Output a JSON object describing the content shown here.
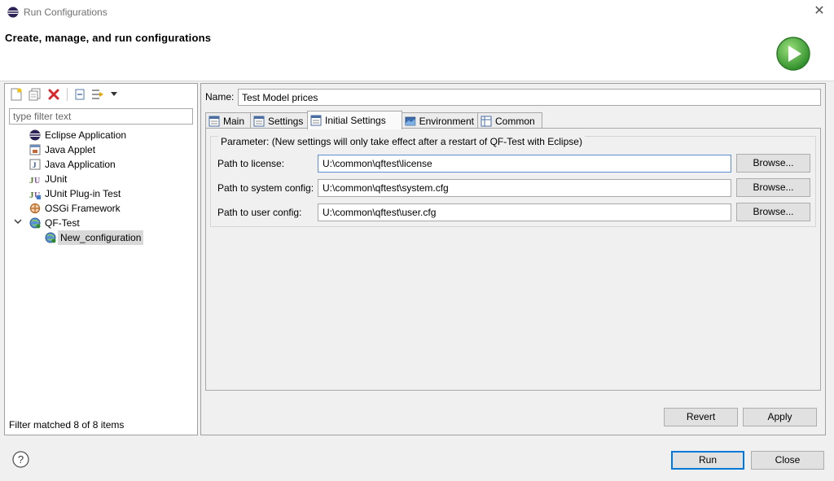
{
  "window": {
    "title": "Run Configurations",
    "close_glyph": "✕"
  },
  "banner": {
    "heading": "Create, manage, and run configurations",
    "icon": "run-icon"
  },
  "left_panel": {
    "toolbar": [
      "new-configuration-icon",
      "duplicate-icon",
      "delete-icon",
      "collapse-all-icon",
      "filter-icon",
      "view-menu-icon"
    ],
    "filter_placeholder": "type filter text",
    "tree": [
      {
        "label": "Eclipse Application",
        "icon": "eclipse-icon"
      },
      {
        "label": "Java Applet",
        "icon": "java-applet-icon"
      },
      {
        "label": "Java Application",
        "icon": "java-application-icon"
      },
      {
        "label": "JUnit",
        "icon": "junit-icon"
      },
      {
        "label": "JUnit Plug-in Test",
        "icon": "junit-plugin-icon"
      },
      {
        "label": "OSGi Framework",
        "icon": "osgi-icon"
      },
      {
        "label": "QF-Test",
        "icon": "qftest-icon",
        "expanded": true
      },
      {
        "label": "New_configuration",
        "icon": "qftest-config-icon",
        "selected": true
      }
    ],
    "status": "Filter matched 8 of 8 items"
  },
  "form": {
    "name_label": "Name:",
    "name_value": "Test Model prices",
    "tabs": [
      {
        "label": "Main",
        "icon": "main-tab-icon"
      },
      {
        "label": "Settings",
        "icon": "settings-tab-icon"
      },
      {
        "label": "Initial Settings",
        "icon": "initial-settings-tab-icon",
        "active": true
      },
      {
        "label": "Environment",
        "icon": "environment-tab-icon"
      },
      {
        "label": "Common",
        "icon": "common-tab-icon"
      }
    ],
    "group_title": "Parameter: (New settings will only take effect after a restart of QF-Test with Eclipse)",
    "fields": [
      {
        "label": "Path to license:",
        "value": "U:\\common\\qftest\\license",
        "button": "Browse..."
      },
      {
        "label": "Path to system config:",
        "value": "U:\\common\\qftest\\system.cfg",
        "button": "Browse..."
      },
      {
        "label": "Path to user config:",
        "value": "U:\\common\\qftest\\user.cfg",
        "button": "Browse..."
      }
    ],
    "revert_label": "Revert",
    "apply_label": "Apply"
  },
  "footer": {
    "help_icon": "help-icon",
    "run_label": "Run",
    "close_label": "Close"
  },
  "colors": {
    "accent": "#0078d7",
    "selection": "#d9d9d9",
    "run_green": "#3aa639",
    "delete_red": "#d9262b"
  }
}
